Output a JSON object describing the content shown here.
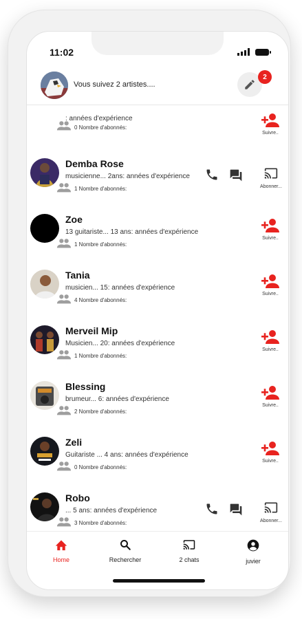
{
  "status_bar": {
    "time": "11:02"
  },
  "header": {
    "title": "Vous suivez 2 artistes....",
    "notification_count": "2"
  },
  "colors": {
    "accent": "#e8231f",
    "icon_gray": "#9e9e9e",
    "icon_dark": "#333333"
  },
  "artists": [
    {
      "name": "",
      "description": ": années d'expérience",
      "followers": "0 Nombre d'abonnés:",
      "action": "Suivre..",
      "avatar": "none"
    },
    {
      "name": "Demba Rose",
      "description": "musicienne... 2ans: années d'expérience",
      "followers": "1 Nombre d'abonnés:",
      "action": "Abonner...",
      "avatar": "photo-purple"
    },
    {
      "name": "Zoe",
      "description": "13 guitariste... 13 ans: années d'expérience",
      "followers": "1 Nombre d'abonnés:",
      "action": "Suivre..",
      "avatar": "black"
    },
    {
      "name": "Tania",
      "description": "musicien... 15: années d'expérience",
      "followers": "4 Nombre d'abonnés:",
      "action": "Suivre..",
      "avatar": "photo-light"
    },
    {
      "name": "Merveil Mip",
      "description": "Musicien... 20: années d'expérience",
      "followers": "1 Nombre d'abonnés:",
      "action": "Suivre..",
      "avatar": "photo-stage"
    },
    {
      "name": "Blessing",
      "description": "brumeur... 6: années d'expérience",
      "followers": "2 Nombre d'abonnés:",
      "action": "Suivre..",
      "avatar": "photo-amp"
    },
    {
      "name": "Zeli",
      "description": "Guitariste ... 4 ans: années d'expérience",
      "followers": "0 Nombre d'abonnés:",
      "action": "Suivre..",
      "avatar": "photo-poster"
    },
    {
      "name": "Robo",
      "description": "... 5 ans: années d'expérience",
      "followers": "3 Nombre d'abonnés:",
      "action": "Abonner...",
      "avatar": "photo-dark"
    }
  ],
  "nav": [
    {
      "label": "Home",
      "icon": "home-icon",
      "active": true
    },
    {
      "label": "Rechercher",
      "icon": "search-icon",
      "active": false
    },
    {
      "label": "2 chats",
      "icon": "cast-icon",
      "active": false
    },
    {
      "label": "juvier",
      "icon": "account-icon",
      "active": false
    }
  ]
}
